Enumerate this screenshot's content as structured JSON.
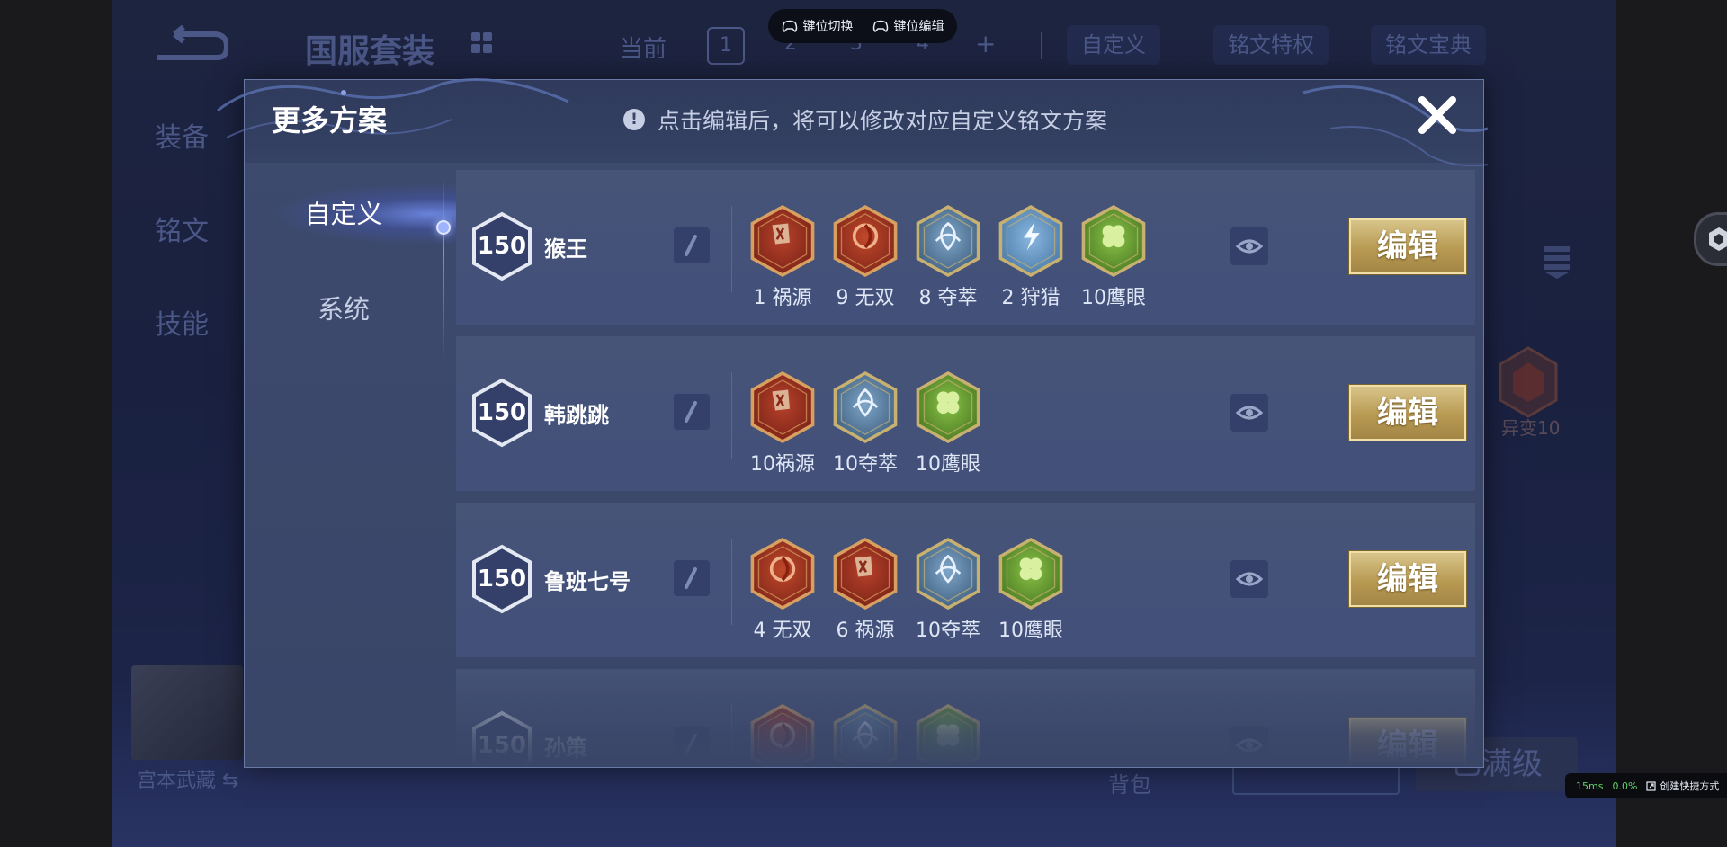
{
  "background": {
    "title": "国服套装",
    "current_label": "当前",
    "pages": [
      "1",
      "2",
      "3",
      "4"
    ],
    "plus": "+",
    "tabs": [
      "自定义",
      "铭文特权",
      "铭文宝典"
    ],
    "side_tabs": [
      "装备",
      "铭文",
      "技能"
    ],
    "hero_name": "宫本武藏 ⇆",
    "bag_label": "背包",
    "max_label": "已满级",
    "variant_label": "异变10"
  },
  "keymap": {
    "switch_label": "键位切换",
    "edit_label": "键位编辑"
  },
  "perf": {
    "latency": "15ms",
    "loss": "0.0%",
    "shortcut_label": "创建快捷方式"
  },
  "modal": {
    "title": "更多方案",
    "hint": "点击编辑后，将可以修改对应自定义铭文方案",
    "close_icon": "close-icon",
    "tabs": [
      {
        "label": "自定义",
        "active": true
      },
      {
        "label": "系统",
        "active": false
      }
    ],
    "edit_label": "编辑",
    "plans": [
      {
        "level": "150",
        "hero": "猴王",
        "runes": [
          {
            "color": "red-card",
            "label": "1 祸源"
          },
          {
            "color": "red-swirl",
            "label": "9 无双"
          },
          {
            "color": "blue-knot",
            "label": "8 夺萃"
          },
          {
            "color": "blue-bolt",
            "label": "2 狩猎"
          },
          {
            "color": "green-clover",
            "label": "10鹰眼"
          }
        ]
      },
      {
        "level": "150",
        "hero": "韩跳跳",
        "runes": [
          {
            "color": "red-card",
            "label": "10祸源"
          },
          {
            "color": "blue-knot",
            "label": "10夺萃"
          },
          {
            "color": "green-clover",
            "label": "10鹰眼"
          }
        ]
      },
      {
        "level": "150",
        "hero": "鲁班七号",
        "runes": [
          {
            "color": "red-swirl",
            "label": "4 无双"
          },
          {
            "color": "red-card",
            "label": "6 祸源"
          },
          {
            "color": "blue-knot",
            "label": "10夺萃"
          },
          {
            "color": "green-clover",
            "label": "10鹰眼"
          }
        ]
      },
      {
        "level": "150",
        "hero": "孙策",
        "runes": [
          {
            "color": "red-swirl",
            "label": ""
          },
          {
            "color": "blue-knot",
            "label": ""
          },
          {
            "color": "green-clover",
            "label": ""
          }
        ]
      }
    ]
  }
}
